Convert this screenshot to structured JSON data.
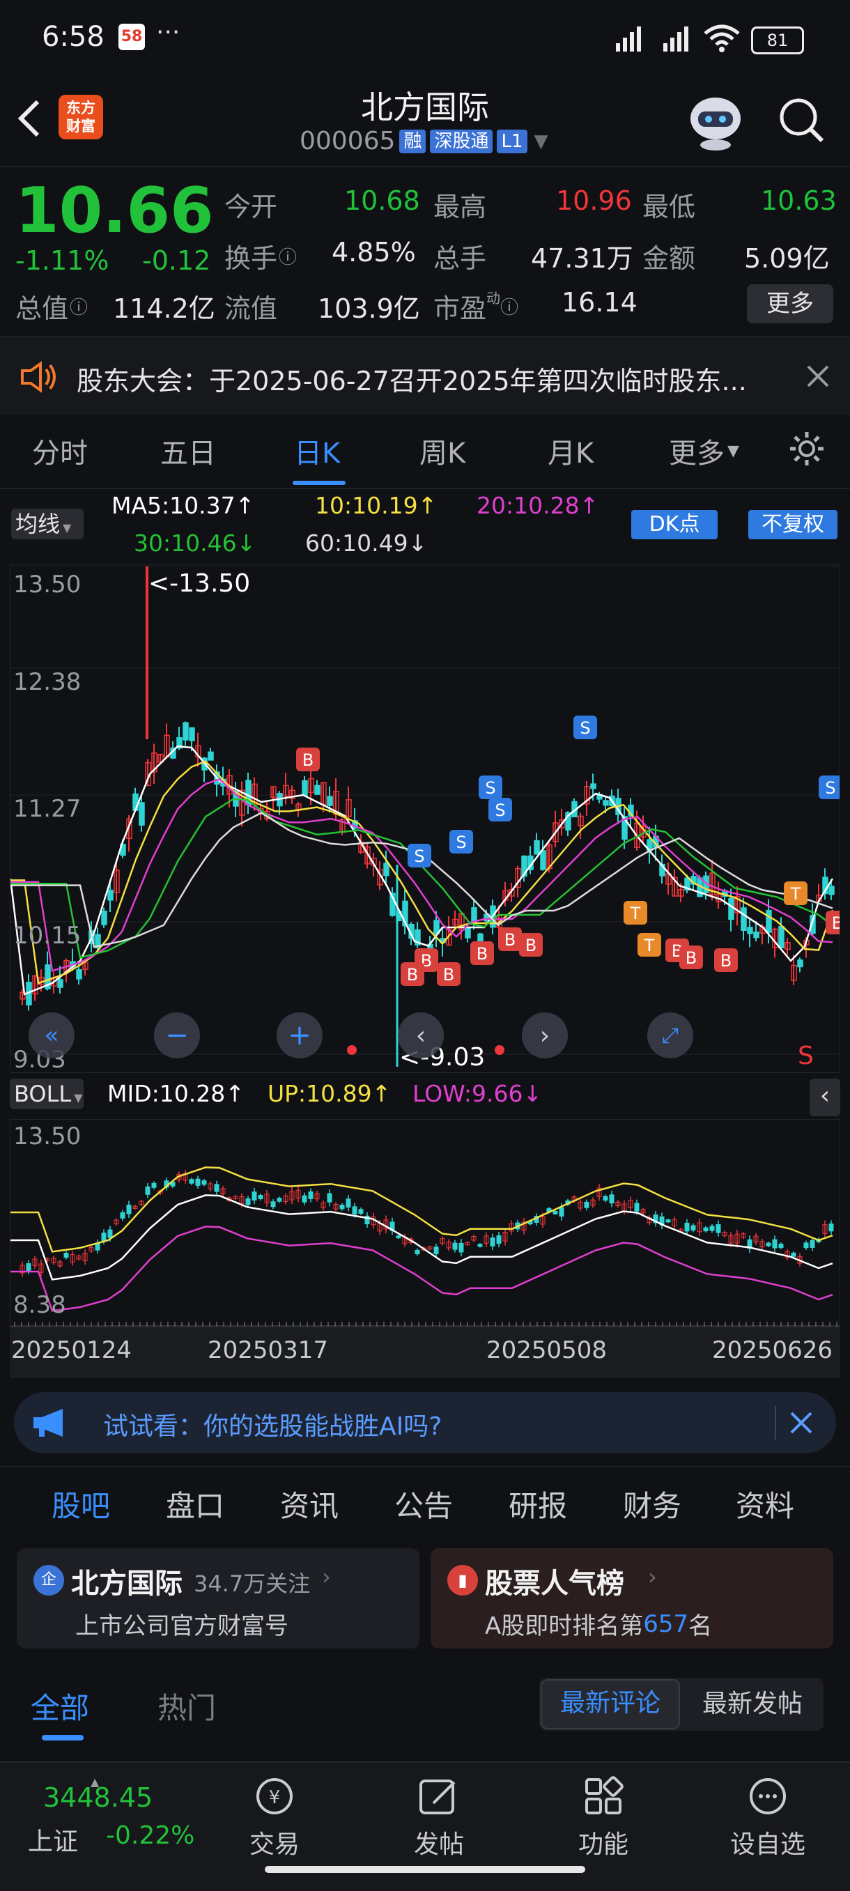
{
  "status_bar": {
    "time": "6:58",
    "app_badge": "58",
    "dots": "···",
    "battery": "81"
  },
  "header": {
    "logo": "东方\n财富",
    "title": "北方国际",
    "code": "000065",
    "tags": [
      "融",
      "深股通",
      "L1"
    ]
  },
  "quote": {
    "price": "10.66",
    "change_pct": "-1.11%",
    "change": "-0.12",
    "open_label": "今开",
    "open": "10.68",
    "high_label": "最高",
    "high": "10.96",
    "low_label": "最低",
    "low": "10.63",
    "turnover_label": "换手",
    "turnover": "4.85%",
    "volume_label": "总手",
    "volume": "47.31万",
    "amount_label": "金额",
    "amount": "5.09亿",
    "mcap_label": "总值",
    "mcap": "114.2亿",
    "float_label": "流值",
    "float": "103.9亿",
    "pe_label": "市盈",
    "pe_sup": "动",
    "pe": "16.14",
    "more_btn": "更多"
  },
  "notice": {
    "text": "股东大会：于2025-06-27召开2025年第四次临时股东..."
  },
  "period_tabs": [
    "分时",
    "五日",
    "日K",
    "周K",
    "月K",
    "更多"
  ],
  "period_active": "日K",
  "ma_bar": {
    "selector": "均线",
    "ma5": "MA5:10.37↑",
    "ma10": "10:10.19↑",
    "ma20": "20:10.28↑",
    "ma30": "30:10.46↓",
    "ma60": "60:10.49↓",
    "dk_btn": "DK点",
    "fq_btn": "不复权",
    "colors": {
      "ma5": "#ffffff",
      "ma10": "#f5e042",
      "ma20": "#e040d0",
      "ma30": "#25c235",
      "ma60": "#dddddd"
    }
  },
  "main_chart": {
    "y_labels": [
      "13.50",
      "12.38",
      "11.27",
      "10.15",
      "9.03"
    ],
    "max_marker": "<-13.50",
    "min_marker": "<-9.03",
    "signal_s": "S"
  },
  "boll_bar": {
    "selector": "BOLL",
    "mid": "MID:10.28↑",
    "up": "UP:10.89↑",
    "low": "LOW:9.66↓"
  },
  "boll_chart": {
    "y_top": "13.50",
    "y_bottom": "8.38"
  },
  "x_dates": [
    "20250124",
    "20250317",
    "20250508",
    "20250626"
  ],
  "promo": {
    "text": "试试看：你的选股能战胜AI吗?"
  },
  "content_tabs": [
    "股吧",
    "盘口",
    "资讯",
    "公告",
    "研报",
    "财务",
    "资料"
  ],
  "content_active": "股吧",
  "cards": {
    "left_title": "北方国际",
    "left_followers": "34.7万关注",
    "left_sub": "上市公司官方财富号",
    "right_title": "股票人气榜",
    "right_sub_pre": "A股即时排名第",
    "right_rank": "657",
    "right_sub_post": "名"
  },
  "feed_tabs": {
    "all": "全部",
    "hot": "热门",
    "latest_comment": "最新评论",
    "latest_post": "最新发帖"
  },
  "bottom_bar": {
    "index_value": "3448.45",
    "index_name": "上证",
    "index_change": "-0.22%",
    "items": [
      "交易",
      "发帖",
      "功能",
      "设自选"
    ]
  }
}
